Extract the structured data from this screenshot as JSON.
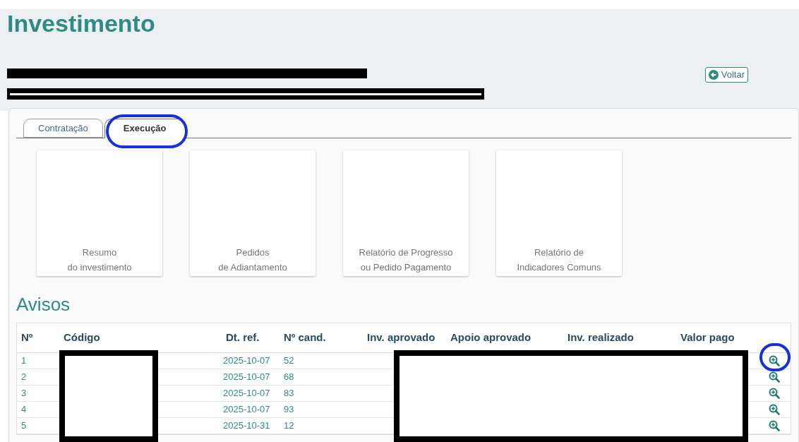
{
  "page": {
    "title": "Investimento"
  },
  "back_button": {
    "label": "Voltar"
  },
  "tabs": [
    {
      "label": "Contratação",
      "selected": false
    },
    {
      "label": "Execução",
      "selected": true
    }
  ],
  "cards": [
    {
      "lines": [
        "Resumo",
        "do investimento"
      ]
    },
    {
      "lines": [
        "Pedidos",
        "de Adiantamento"
      ]
    },
    {
      "lines": [
        "Relatório de Progresso",
        "ou Pedido Pagamento"
      ]
    },
    {
      "lines": [
        "Relatório de",
        "Indicadores Comuns"
      ]
    }
  ],
  "section_title": "Avisos",
  "table": {
    "columns": [
      "Nº",
      "Código",
      "Dt. ref.",
      "Nº cand.",
      "Inv. aprovado",
      "Apoio aprovado",
      "Inv. realizado",
      "Valor pago"
    ],
    "rows": [
      {
        "n": "1",
        "dt_ref": "2025-10-07",
        "n_cand": "52"
      },
      {
        "n": "2",
        "dt_ref": "2025-10-07",
        "n_cand": "68"
      },
      {
        "n": "3",
        "dt_ref": "2025-10-07",
        "n_cand": "83"
      },
      {
        "n": "4",
        "dt_ref": "2025-10-07",
        "n_cand": "93"
      },
      {
        "n": "5",
        "dt_ref": "2025-10-31",
        "n_cand": "12"
      }
    ]
  }
}
